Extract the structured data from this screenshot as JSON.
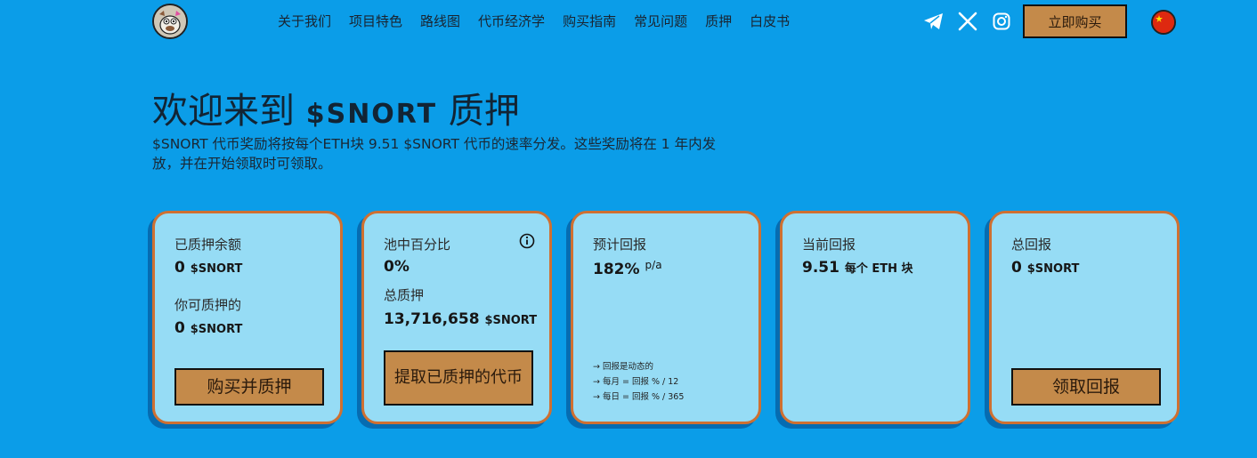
{
  "nav": {
    "items": [
      {
        "label": "关于我们"
      },
      {
        "label": "项目特色"
      },
      {
        "label": "路线图"
      },
      {
        "label": "代币经济学"
      },
      {
        "label": "购买指南"
      },
      {
        "label": "常见问题"
      },
      {
        "label": "质押"
      },
      {
        "label": "白皮书"
      }
    ],
    "socials": [
      "telegram-icon",
      "x-icon",
      "instagram-icon"
    ],
    "buy_now": "立即购买",
    "language_flag": "china-flag-icon"
  },
  "hero": {
    "title_prefix": "欢迎来到",
    "title_brand": "$SNORT",
    "title_suffix": "质押",
    "subtitle": "$SNORT 代币奖励将按每个ETH块 9.51 $SNORT 代币的速率分发。这些奖励将在 1 年内发放，并在开始领取时可领取。"
  },
  "cards": {
    "staked": {
      "label": "已质押余额",
      "value": "0",
      "unit": "$SNORT",
      "stakable_label": "你可质押的",
      "stakable_value": "0",
      "stakable_unit": "$SNORT",
      "button": "购买并质押"
    },
    "pool": {
      "label": "池中百分比",
      "value": "0%",
      "total_label": "总质押",
      "total_value": "13,716,658",
      "total_unit": "$SNORT",
      "button": "提取已质押的代币"
    },
    "estimated": {
      "label": "预计回报",
      "value": "182%",
      "suffix": "p/a",
      "notes": [
        "→ 回报是动态的",
        "→ 每月 = 回报 % / 12",
        "→ 每日 = 回报 % / 365"
      ]
    },
    "current": {
      "label": "当前回报",
      "value": "9.51",
      "unit": "每个 ETH 块"
    },
    "total": {
      "label": "总回报",
      "value": "0",
      "unit": "$SNORT",
      "button": "领取回报"
    }
  },
  "colors": {
    "background": "#0b9de8",
    "card": "#96dcf5",
    "card_border": "#cf7031",
    "button": "#c48a4a"
  }
}
